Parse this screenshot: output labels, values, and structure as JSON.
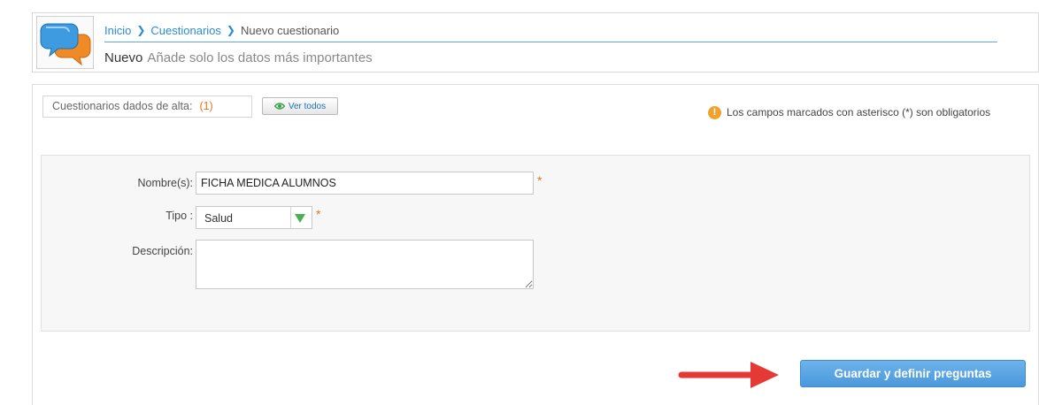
{
  "breadcrumb": {
    "items": [
      "Inicio",
      "Cuestionarios",
      "Nuevo cuestionario"
    ]
  },
  "header": {
    "title": "Nuevo",
    "subtitle": "Añade solo los datos más importantes"
  },
  "summary": {
    "label": "Cuestionarios dados de alta:",
    "count": "(1)",
    "view_all_label": "Ver todos",
    "view_all_icon": "eye-icon"
  },
  "notice": {
    "icon": "warning-icon",
    "text": "Los campos marcados con asterisco (*) son obligatorios"
  },
  "form": {
    "name_label": "Nombre(s):",
    "name_value": "FICHA MEDICA ALUMNOS",
    "type_label": "Tipo :",
    "type_value": "Salud",
    "description_label": "Descripción:",
    "description_value": "",
    "required_mark": "*"
  },
  "actions": {
    "submit_label": "Guardar y definir preguntas"
  },
  "colors": {
    "link": "#2a8bd6",
    "accent_orange": "#e07a1d",
    "button_blue": "#4a98db",
    "arrow_red": "#e53935",
    "select_arrow_green": "#4caf50"
  }
}
